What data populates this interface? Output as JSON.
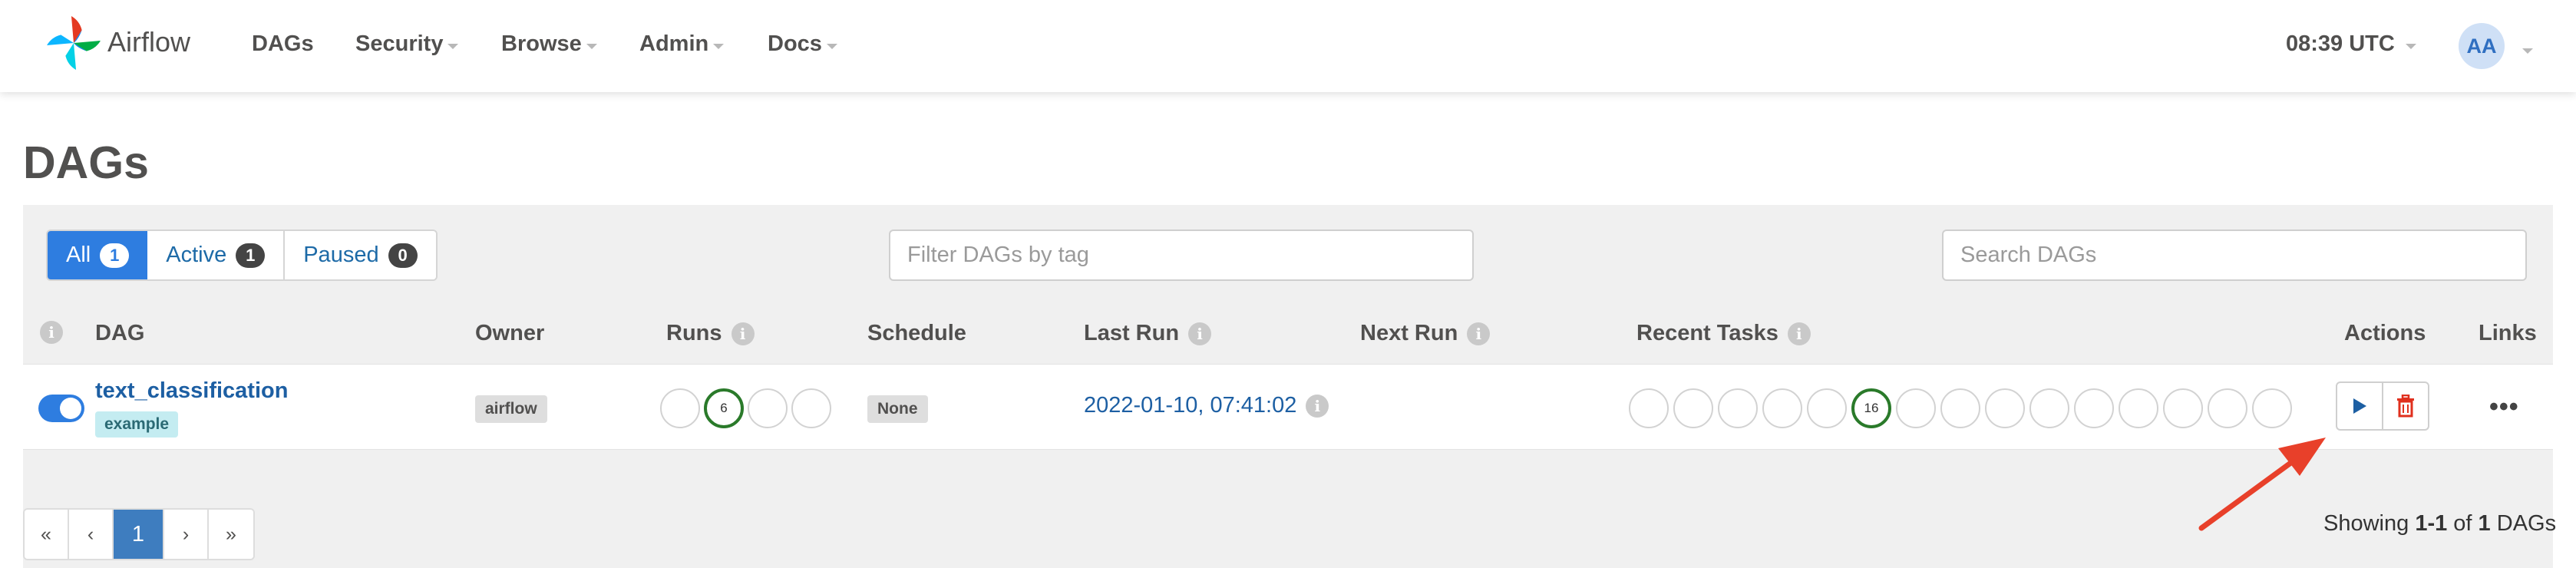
{
  "brand": "Airflow",
  "nav": {
    "items": [
      "DAGs",
      "Security",
      "Browse",
      "Admin",
      "Docs"
    ],
    "time": "08:39 UTC",
    "user_initials": "AA"
  },
  "page_title": "DAGs",
  "filters": {
    "all_label": "All",
    "all_count": "1",
    "active_label": "Active",
    "active_count": "1",
    "paused_label": "Paused",
    "paused_count": "0",
    "tag_placeholder": "Filter DAGs by tag",
    "search_placeholder": "Search DAGs"
  },
  "table": {
    "headers": {
      "dag": "DAG",
      "owner": "Owner",
      "runs": "Runs",
      "schedule": "Schedule",
      "last_run": "Last Run",
      "next_run": "Next Run",
      "recent_tasks": "Recent Tasks",
      "actions": "Actions",
      "links": "Links"
    },
    "row": {
      "active": true,
      "dag_id": "text_classification",
      "tag": "example",
      "owner": "airflow",
      "runs": [
        "",
        "6",
        "",
        ""
      ],
      "schedule": "None",
      "last_run": "2022-01-10, 07:41:02",
      "next_run": "",
      "recent_tasks": [
        "",
        "",
        "",
        "",
        "",
        "16",
        "",
        "",
        "",
        "",
        "",
        "",
        "",
        "",
        ""
      ]
    }
  },
  "pagination": {
    "first": "«",
    "prev": "‹",
    "current": "1",
    "next": "›",
    "last": "»"
  },
  "showing": {
    "prefix": "Showing",
    "range": "1-1",
    "of": "of",
    "total": "1",
    "suffix": "DAGs"
  },
  "colors": {
    "primary": "#2e7de0",
    "link": "#1d5fa3",
    "success": "#2a7a2a",
    "danger": "#e0301e",
    "annotation_arrow": "#e8402a"
  }
}
